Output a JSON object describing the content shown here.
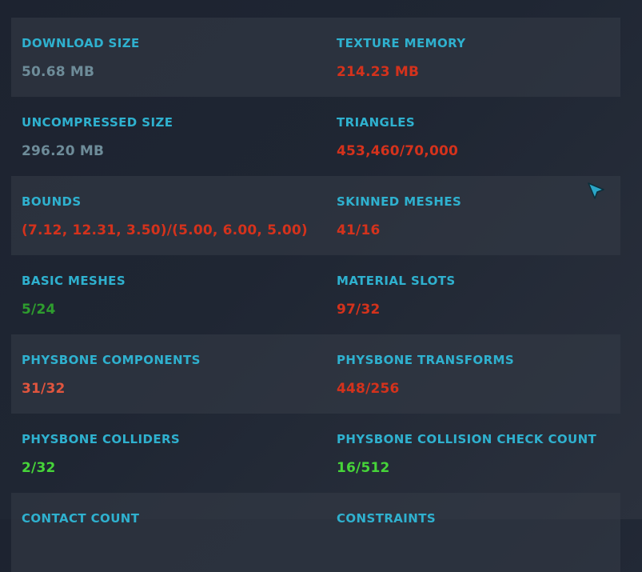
{
  "colors": {
    "label": "#2fb1cf",
    "neutral": "#6e8c99",
    "bad": "#d4321c",
    "warn": "#e0553e",
    "medium": "#2e9d2e",
    "good": "#46d439",
    "cursor": "#2ba6c8"
  },
  "stats": [
    {
      "left": {
        "label": "DOWNLOAD SIZE",
        "value": "50.68 MB",
        "status": "neutral"
      },
      "right": {
        "label": "TEXTURE MEMORY",
        "value": "214.23 MB",
        "status": "bad"
      }
    },
    {
      "left": {
        "label": "UNCOMPRESSED SIZE",
        "value": "296.20 MB",
        "status": "neutral"
      },
      "right": {
        "label": "TRIANGLES",
        "value": "453,460/70,000",
        "status": "bad"
      }
    },
    {
      "left": {
        "label": "BOUNDS",
        "value": "(7.12, 12.31, 3.50)/(5.00, 6.00, 5.00)",
        "status": "bad"
      },
      "right": {
        "label": "SKINNED MESHES",
        "value": "41/16",
        "status": "bad"
      }
    },
    {
      "left": {
        "label": "BASIC MESHES",
        "value": "5/24",
        "status": "medium"
      },
      "right": {
        "label": "MATERIAL SLOTS",
        "value": "97/32",
        "status": "bad"
      }
    },
    {
      "left": {
        "label": "PHYSBONE COMPONENTS",
        "value": "31/32",
        "status": "warn"
      },
      "right": {
        "label": "PHYSBONE TRANSFORMS",
        "value": "448/256",
        "status": "bad"
      }
    },
    {
      "left": {
        "label": "PHYSBONE COLLIDERS",
        "value": "2/32",
        "status": "good"
      },
      "right": {
        "label": "PHYSBONE COLLISION CHECK COUNT",
        "value": "16/512",
        "status": "good"
      }
    },
    {
      "left": {
        "label": "CONTACT COUNT",
        "value": "",
        "status": "neutral"
      },
      "right": {
        "label": "CONSTRAINTS",
        "value": "",
        "status": "neutral"
      }
    }
  ],
  "cursor_icon": "pointer-arrow-icon"
}
